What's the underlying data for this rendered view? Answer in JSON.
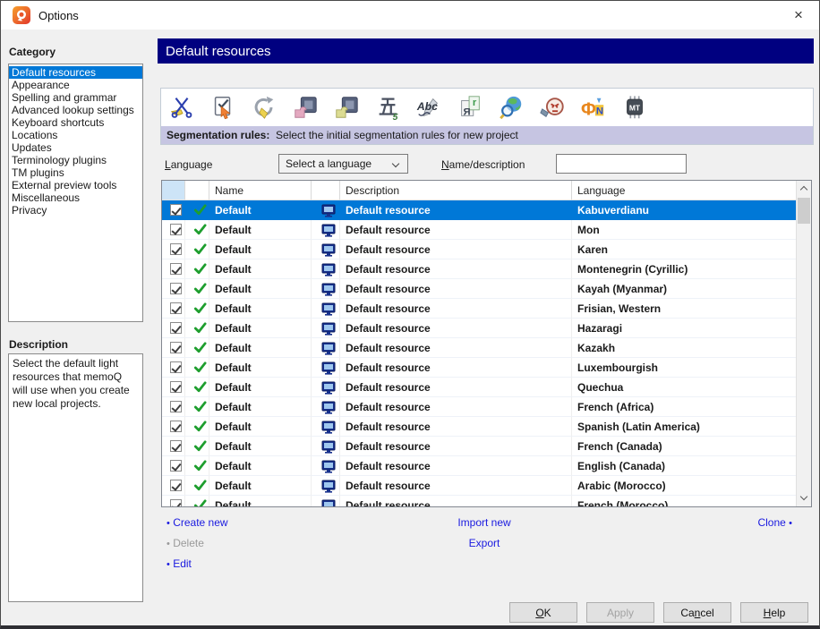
{
  "window": {
    "title": "Options",
    "close_glyph": "×"
  },
  "colors": {
    "selection_blue": "#0078d7",
    "header_navy": "#000080",
    "status_strip_lavender": "#c6c5e2",
    "link_blue": "#1a1ae0",
    "disabled_gray": "#9a9a9a",
    "logo_orange": "#f7a02b",
    "logo_red": "#e2362c"
  },
  "sidebar": {
    "category_label": "Category",
    "items": [
      {
        "label": "Default resources",
        "selected": true
      },
      {
        "label": "Appearance",
        "selected": false
      },
      {
        "label": "Spelling and grammar",
        "selected": false
      },
      {
        "label": "Advanced lookup settings",
        "selected": false
      },
      {
        "label": "Keyboard shortcuts",
        "selected": false
      },
      {
        "label": "Locations",
        "selected": false
      },
      {
        "label": "Updates",
        "selected": false
      },
      {
        "label": "Terminology plugins",
        "selected": false
      },
      {
        "label": "TM plugins",
        "selected": false
      },
      {
        "label": "External preview tools",
        "selected": false
      },
      {
        "label": "Miscellaneous",
        "selected": false
      },
      {
        "label": "Privacy",
        "selected": false
      }
    ],
    "description_label": "Description",
    "description_text": "Select the default light resources that memoQ will use when you create new local projects."
  },
  "main": {
    "header_title": "Default resources",
    "toolbar": {
      "icons": [
        "segmentation-rules",
        "qa-settings",
        "auto-translation-rules",
        "non-translatable-lists",
        "auto-correct-lists",
        "number-formats",
        "ignore-lists",
        "export-path-rules",
        "web-search-settings",
        "lqa-models",
        "font-substitution",
        "machine-translation"
      ],
      "status_label": "Segmentation rules:",
      "status_text": "  Select the initial segmentation rules for new project"
    },
    "filters": {
      "language_label": {
        "text": "Language",
        "underline": 0
      },
      "language_value": "Select a language",
      "name_label": {
        "text": "Name/description",
        "underline": 0
      },
      "name_value": ""
    },
    "table": {
      "columns": {
        "name": "Name",
        "description": "Description",
        "language": "Language"
      },
      "rows": [
        {
          "name": "Default",
          "description": "Default resource",
          "language": "Kabuverdianu",
          "checked": true,
          "selected": true
        },
        {
          "name": "Default",
          "description": "Default resource",
          "language": "Mon",
          "checked": true,
          "selected": false
        },
        {
          "name": "Default",
          "description": "Default resource",
          "language": "Karen",
          "checked": true,
          "selected": false
        },
        {
          "name": "Default",
          "description": "Default resource",
          "language": "Montenegrin (Cyrillic)",
          "checked": true,
          "selected": false
        },
        {
          "name": "Default",
          "description": "Default resource",
          "language": "Kayah (Myanmar)",
          "checked": true,
          "selected": false
        },
        {
          "name": "Default",
          "description": "Default resource",
          "language": "Frisian, Western",
          "checked": true,
          "selected": false
        },
        {
          "name": "Default",
          "description": "Default resource",
          "language": "Hazaragi",
          "checked": true,
          "selected": false
        },
        {
          "name": "Default",
          "description": "Default resource",
          "language": "Kazakh",
          "checked": true,
          "selected": false
        },
        {
          "name": "Default",
          "description": "Default resource",
          "language": "Luxembourgish",
          "checked": true,
          "selected": false
        },
        {
          "name": "Default",
          "description": "Default resource",
          "language": "Quechua",
          "checked": true,
          "selected": false
        },
        {
          "name": "Default",
          "description": "Default resource",
          "language": "French (Africa)",
          "checked": true,
          "selected": false
        },
        {
          "name": "Default",
          "description": "Default resource",
          "language": "Spanish (Latin America)",
          "checked": true,
          "selected": false
        },
        {
          "name": "Default",
          "description": "Default resource",
          "language": "French (Canada)",
          "checked": true,
          "selected": false
        },
        {
          "name": "Default",
          "description": "Default resource",
          "language": "English (Canada)",
          "checked": true,
          "selected": false
        },
        {
          "name": "Default",
          "description": "Default resource",
          "language": "Arabic (Morocco)",
          "checked": true,
          "selected": false
        },
        {
          "name": "Default",
          "description": "Default resource",
          "language": "French (Morocco)",
          "checked": true,
          "selected": false
        }
      ]
    },
    "links": {
      "create_new": "Create new",
      "delete": "Delete",
      "edit": "Edit",
      "import_new": "Import new",
      "export": "Export",
      "clone": "Clone"
    },
    "buttons": [
      {
        "label": "OK",
        "underline": 0,
        "disabled": false
      },
      {
        "label": "Apply",
        "underline": -1,
        "disabled": true
      },
      {
        "label": "Cancel",
        "underline": 2,
        "disabled": false
      },
      {
        "label": "Help",
        "underline": 0,
        "disabled": false
      }
    ]
  }
}
